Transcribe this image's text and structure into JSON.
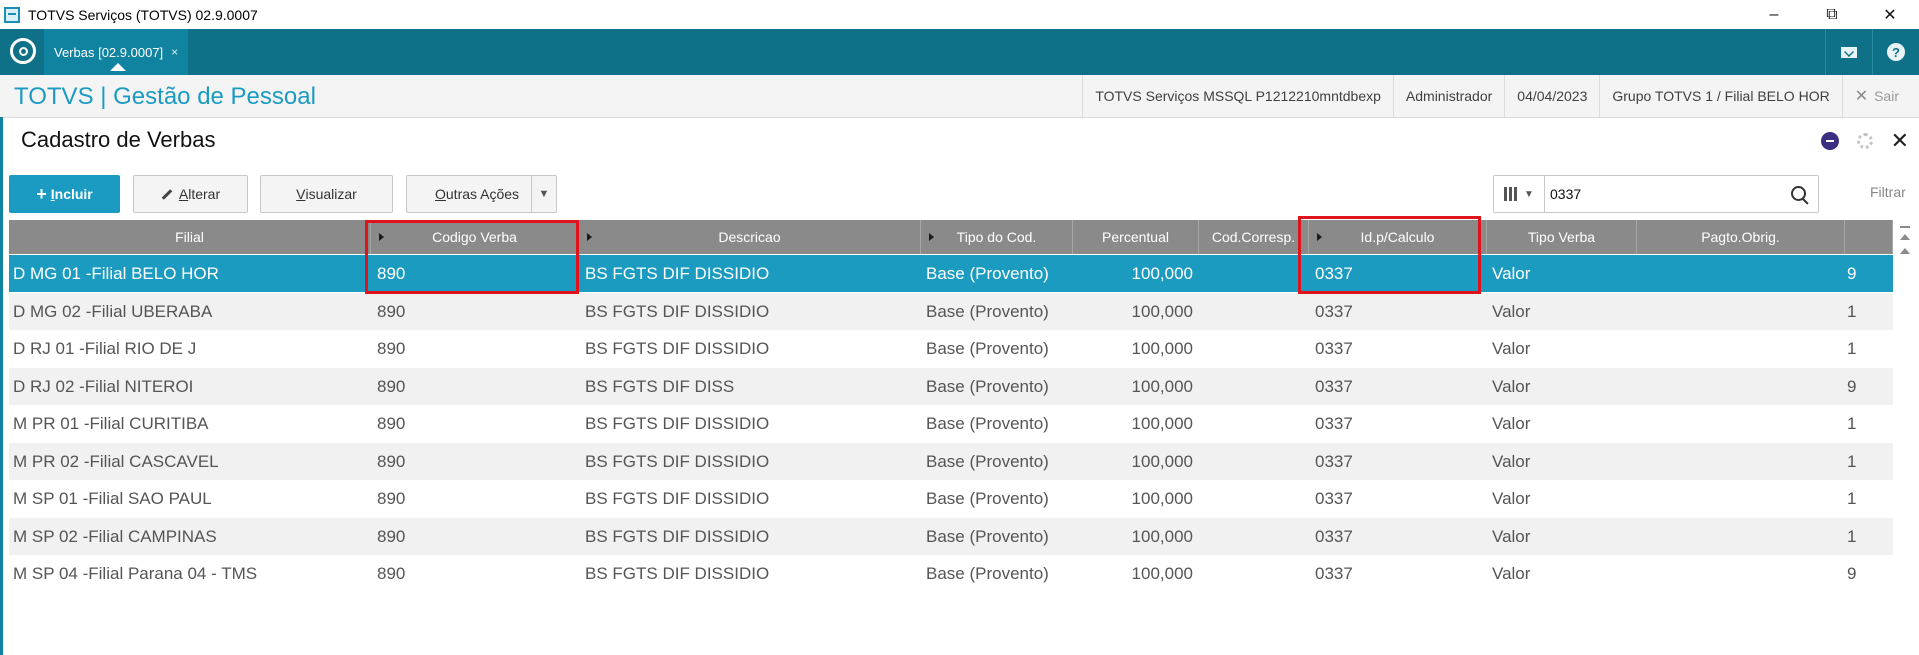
{
  "window": {
    "title": "TOTVS Serviços (TOTVS) 02.9.0007"
  },
  "tabs": [
    {
      "label": "Verbas [02.9.0007]",
      "close": "×"
    }
  ],
  "header": {
    "brand": "TOTVS | Gestão de Pessoal",
    "environment": "TOTVS Serviços MSSQL P1212210mntdbexp",
    "user": "Administrador",
    "date": "04/04/2023",
    "company": "Grupo TOTVS 1 / Filial BELO HOR",
    "logout": "Sair"
  },
  "page": {
    "title": "Cadastro de Verbas"
  },
  "toolbar": {
    "incluir": {
      "prefix": "I",
      "rest": "ncluir"
    },
    "alterar": {
      "prefix": "A",
      "rest": "lterar"
    },
    "visualizar": {
      "prefix": "V",
      "rest": "isualizar"
    },
    "outras": {
      "prefix": "O",
      "rest": "utras Ações"
    }
  },
  "search": {
    "value": "0337"
  },
  "filter_label": "Filtrar",
  "colors": {
    "accent": "#1b9bc2",
    "tabbar": "#0f7188",
    "selected_row": "#1c9bc0",
    "highlight": "#e0121b"
  },
  "grid": {
    "columns": [
      {
        "label": "Filial",
        "sortable": false
      },
      {
        "label": "Codigo Verba",
        "sortable": true
      },
      {
        "label": "Descricao",
        "sortable": true
      },
      {
        "label": "Tipo do Cod.",
        "sortable": true
      },
      {
        "label": "Percentual",
        "sortable": false
      },
      {
        "label": "Cod.Corresp.",
        "sortable": false
      },
      {
        "label": "Id.p/Calculo",
        "sortable": true
      },
      {
        "label": "Tipo Verba",
        "sortable": false
      },
      {
        "label": "Pagto.Obrig.",
        "sortable": false
      },
      {
        "label": "",
        "sortable": false
      }
    ],
    "rows": [
      [
        "D MG 01 -Filial BELO HOR",
        "890",
        "BS FGTS DIF DISSIDIO",
        "Base (Provento)",
        "100,000",
        "",
        "0337",
        "Valor",
        "",
        "9"
      ],
      [
        "D MG 02 -Filial UBERABA",
        "890",
        "BS FGTS DIF DISSIDIO",
        "Base (Provento)",
        "100,000",
        "",
        "0337",
        "Valor",
        "",
        "1"
      ],
      [
        "D RJ 01 -Filial RIO DE J",
        "890",
        "BS FGTS DIF DISSIDIO",
        "Base (Provento)",
        "100,000",
        "",
        "0337",
        "Valor",
        "",
        "1"
      ],
      [
        "D RJ 02 -Filial NITEROI",
        "890",
        "BS FGTS DIF DISS",
        "Base (Provento)",
        "100,000",
        "",
        "0337",
        "Valor",
        "",
        "9"
      ],
      [
        "M PR 01 -Filial CURITIBA",
        "890",
        "BS FGTS DIF DISSIDIO",
        "Base (Provento)",
        "100,000",
        "",
        "0337",
        "Valor",
        "",
        "1"
      ],
      [
        "M PR 02 -Filial CASCAVEL",
        "890",
        "BS FGTS DIF DISSIDIO",
        "Base (Provento)",
        "100,000",
        "",
        "0337",
        "Valor",
        "",
        "1"
      ],
      [
        "M SP 01 -Filial SAO PAUL",
        "890",
        "BS FGTS DIF DISSIDIO",
        "Base (Provento)",
        "100,000",
        "",
        "0337",
        "Valor",
        "",
        "1"
      ],
      [
        "M SP 02 -Filial CAMPINAS",
        "890",
        "BS FGTS DIF DISSIDIO",
        "Base (Provento)",
        "100,000",
        "",
        "0337",
        "Valor",
        "",
        "1"
      ],
      [
        "M SP 04 -Filial Parana 04 - TMS",
        "890",
        "BS FGTS DIF DISSIDIO",
        "Base (Provento)",
        "100,000",
        "",
        "0337",
        "Valor",
        "",
        "9"
      ]
    ],
    "selected_row": 0
  }
}
